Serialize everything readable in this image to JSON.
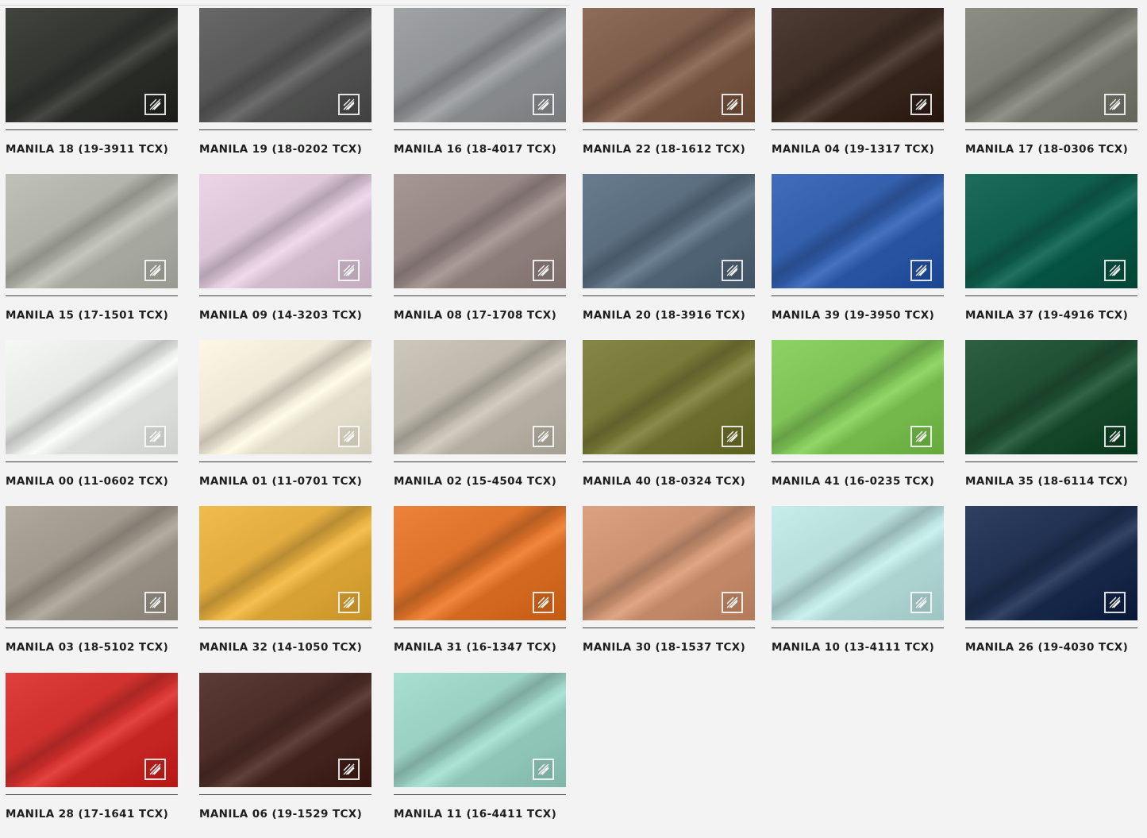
{
  "swatches": [
    {
      "name": "MANILA 18 (19-3911 TCX)",
      "color": "#2f322d"
    },
    {
      "name": "MANILA 19 (18-0202 TCX)",
      "color": "#555655"
    },
    {
      "name": "MANILA 16 (18-4017 TCX)",
      "color": "#8e9193"
    },
    {
      "name": "MANILA 22 (18-1612 TCX)",
      "color": "#7c5a48"
    },
    {
      "name": "MANILA 04 (19-1317 TCX)",
      "color": "#3b2b23"
    },
    {
      "name": "MANILA 17 (18-0306 TCX)",
      "color": "#7a7c72"
    },
    {
      "name": "MANILA 15 (17-1501 TCX)",
      "color": "#aeafa6"
    },
    {
      "name": "MANILA 09 (14-3203 TCX)",
      "color": "#d9c3d4"
    },
    {
      "name": "MANILA 08 (17-1708 TCX)",
      "color": "#948583"
    },
    {
      "name": "MANILA 20 (18-3916 TCX)",
      "color": "#566a7c"
    },
    {
      "name": "MANILA 39 (19-3950 TCX)",
      "color": "#2f5ba8"
    },
    {
      "name": "MANILA 37 (19-4916 TCX)",
      "color": "#0c5b4a"
    },
    {
      "name": "MANILA 00 (11-0602 TCX)",
      "color": "#e4e6e4"
    },
    {
      "name": "MANILA 01 (11-0701 TCX)",
      "color": "#ebe5d3"
    },
    {
      "name": "MANILA 02 (15-4504 TCX)",
      "color": "#bcb6aa"
    },
    {
      "name": "MANILA 40 (18-0324 TCX)",
      "color": "#737534"
    },
    {
      "name": "MANILA 41 (16-0235 TCX)",
      "color": "#7cc054"
    },
    {
      "name": "MANILA 35 (18-6114 TCX)",
      "color": "#1d4d30"
    },
    {
      "name": "MANILA 03 (18-5102 TCX)",
      "color": "#9d968a"
    },
    {
      "name": "MANILA 32 (14-1050 TCX)",
      "color": "#e0a93c"
    },
    {
      "name": "MANILA 31 (16-1347 TCX)",
      "color": "#db7028"
    },
    {
      "name": "MANILA 30 (18-1537 TCX)",
      "color": "#c9906f"
    },
    {
      "name": "MANILA 10 (13-4111 TCX)",
      "color": "#b5dbd9"
    },
    {
      "name": "MANILA 26 (19-4030 TCX)",
      "color": "#1d2e4e"
    },
    {
      "name": "MANILA 28 (17-1641 TCX)",
      "color": "#cd2d2a"
    },
    {
      "name": "MANILA 06 (19-1529 TCX)",
      "color": "#4a2a24"
    },
    {
      "name": "MANILA 11 (16-4411 TCX)",
      "color": "#97cdbf"
    }
  ]
}
